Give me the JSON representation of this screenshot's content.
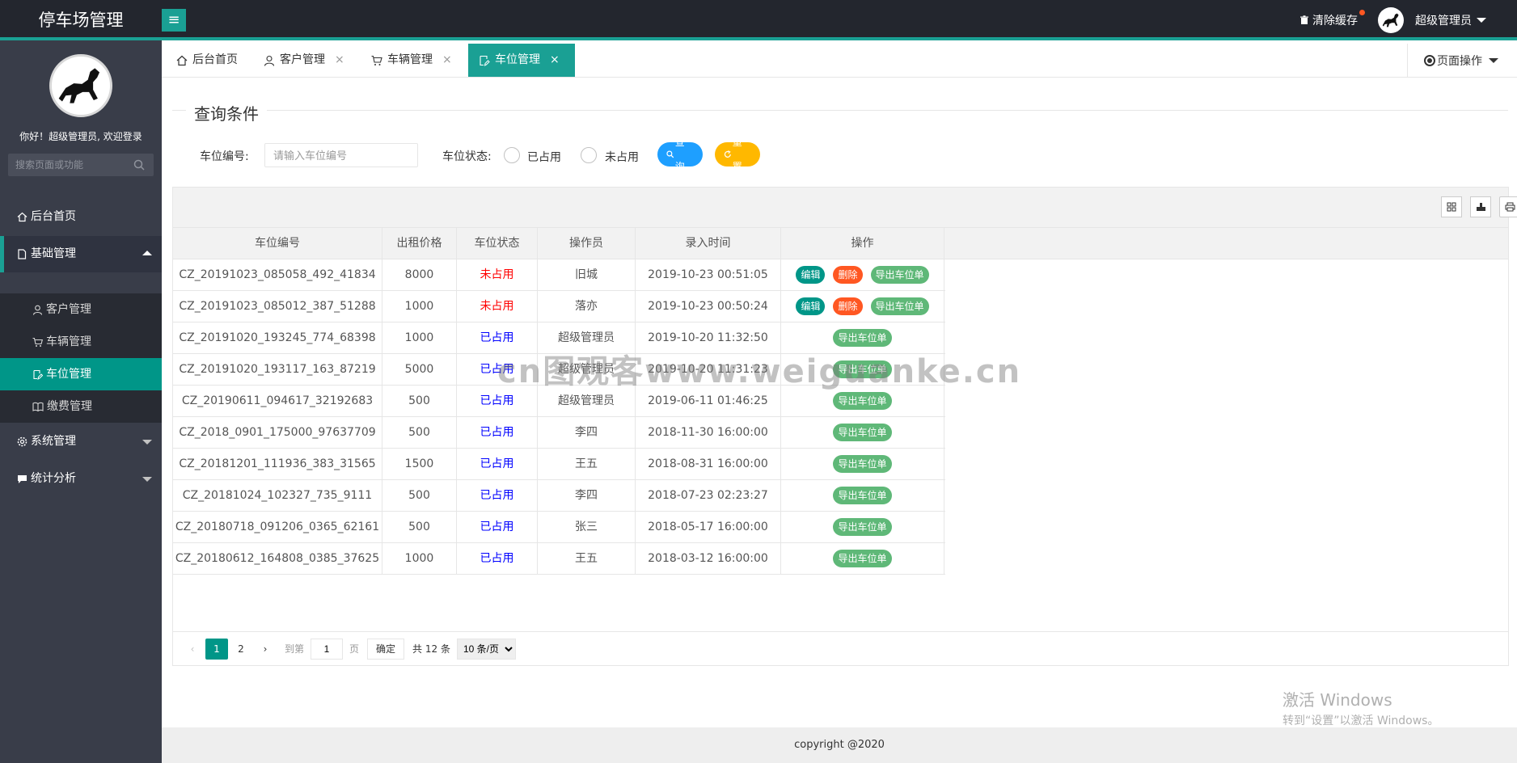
{
  "header": {
    "logo": "停车场管理",
    "menu_icon": "hamburger-icon",
    "clear_cache": "清除缓存",
    "user_name": "超级管理员",
    "accent": "#1aa094"
  },
  "sidebar": {
    "greeting": "你好！超级管理员, 欢迎登录",
    "search_placeholder": "搜索页面或功能",
    "items": [
      {
        "label": "后台首页",
        "icon": "home-icon"
      },
      {
        "label": "基础管理",
        "icon": "file-icon"
      },
      {
        "label": "系统管理",
        "icon": "gear-icon"
      },
      {
        "label": "统计分析",
        "icon": "chart-icon"
      }
    ],
    "sub_items": [
      {
        "label": "客户管理",
        "icon": "user-icon"
      },
      {
        "label": "车辆管理",
        "icon": "cart-icon"
      },
      {
        "label": "车位管理",
        "icon": "edit-icon"
      },
      {
        "label": "缴费管理",
        "icon": "book-icon"
      }
    ]
  },
  "tabs": [
    {
      "label": "后台首页",
      "icon": "home-icon"
    },
    {
      "label": "客户管理",
      "icon": "user-icon",
      "close": "×"
    },
    {
      "label": "车辆管理",
      "icon": "cart-icon",
      "close": "×"
    },
    {
      "label": "车位管理",
      "icon": "edit-icon",
      "close": "×",
      "active": true
    }
  ],
  "page_ops": "页面操作",
  "query": {
    "legend": "查询条件",
    "code_label": "车位编号:",
    "code_placeholder": "请输入车位编号",
    "status_label": "车位状态:",
    "opt_used": "已占用",
    "opt_free": "未占用",
    "search_btn": "查询",
    "reset_btn": "重置"
  },
  "table": {
    "headers": [
      "车位编号",
      "出租价格",
      "车位状态",
      "操作员",
      "录入时间",
      "操作"
    ],
    "edit": "编辑",
    "delete": "删除",
    "export": "导出车位单",
    "rows": [
      {
        "code": "CZ_20191023_085058_492_41834",
        "price": "8000",
        "status": "未占用",
        "free": true,
        "operator": "旧城",
        "time": "2019-10-23 00:51:05"
      },
      {
        "code": "CZ_20191023_085012_387_51288",
        "price": "1000",
        "status": "未占用",
        "free": true,
        "operator": "落亦",
        "time": "2019-10-23 00:50:24"
      },
      {
        "code": "CZ_20191020_193245_774_68398",
        "price": "1000",
        "status": "已占用",
        "free": false,
        "operator": "超级管理员",
        "time": "2019-10-20 11:32:50"
      },
      {
        "code": "CZ_20191020_193117_163_87219",
        "price": "5000",
        "status": "已占用",
        "free": false,
        "operator": "超级管理员",
        "time": "2019-10-20 11:31:23"
      },
      {
        "code": "CZ_20190611_094617_32192683",
        "price": "500",
        "status": "已占用",
        "free": false,
        "operator": "超级管理员",
        "time": "2019-06-11 01:46:25"
      },
      {
        "code": "CZ_2018_0901_175000_97637709",
        "price": "500",
        "status": "已占用",
        "free": false,
        "operator": "李四",
        "time": "2018-11-30 16:00:00"
      },
      {
        "code": "CZ_20181201_111936_383_31565",
        "price": "1500",
        "status": "已占用",
        "free": false,
        "operator": "王五",
        "time": "2018-08-31 16:00:00"
      },
      {
        "code": "CZ_20181024_102327_735_9111",
        "price": "500",
        "status": "已占用",
        "free": false,
        "operator": "李四",
        "time": "2018-07-23 02:23:27"
      },
      {
        "code": "CZ_20180718_091206_0365_62161",
        "price": "500",
        "status": "已占用",
        "free": false,
        "operator": "张三",
        "time": "2018-05-17 16:00:00"
      },
      {
        "code": "CZ_20180612_164808_0385_37625",
        "price": "1000",
        "status": "已占用",
        "free": false,
        "operator": "王五",
        "time": "2018-03-12 16:00:00"
      }
    ]
  },
  "pager": {
    "prev": "‹",
    "pages": [
      "1",
      "2"
    ],
    "next": "›",
    "goto_label": "到第",
    "goto_value": "1",
    "page_unit": "页",
    "confirm": "确定",
    "total": "共 12 条",
    "per_page": "10 条/页"
  },
  "footer": "copyright @2020",
  "watermark": "cn图观客www.weiguanke.cn",
  "windows": {
    "line1": "激活 Windows",
    "line2": "转到“设置”以激活 Windows。"
  }
}
